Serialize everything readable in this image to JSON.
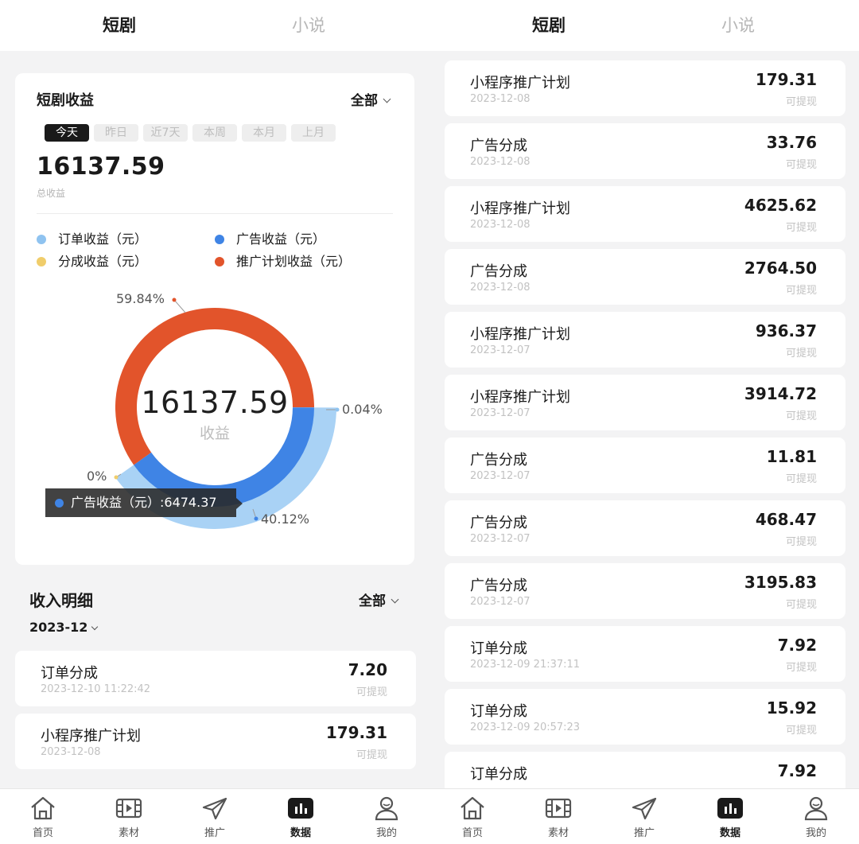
{
  "left": {
    "tabs": [
      {
        "label": "短剧",
        "active": true
      },
      {
        "label": "小说",
        "active": false
      }
    ],
    "earnings": {
      "title": "短剧收益",
      "filter_label": "全部",
      "ranges": [
        {
          "label": "今天",
          "active": true
        },
        {
          "label": "昨日",
          "active": false
        },
        {
          "label": "近7天",
          "active": false
        },
        {
          "label": "本周",
          "active": false
        },
        {
          "label": "本月",
          "active": false
        },
        {
          "label": "上月",
          "active": false
        }
      ],
      "total": "16137.59",
      "total_label": "总收益",
      "legend": [
        {
          "label": "订单收益（元）",
          "color": "#8fc3f0"
        },
        {
          "label": "广告收益（元）",
          "color": "#3f84e5"
        },
        {
          "label": "分成收益（元）",
          "color": "#f0cd6b"
        },
        {
          "label": "推广计划收益（元）",
          "color": "#e2542b"
        }
      ],
      "donut": {
        "center_value": "16137.59",
        "center_label": "收益",
        "slices": [
          {
            "name": "推广计划收益（元）",
            "percent": 59.84,
            "label": "59.84%",
            "color": "#e2542b"
          },
          {
            "name": "订单收益（元）",
            "percent": 0.04,
            "label": "0.04%",
            "color": "#8fc3f0"
          },
          {
            "name": "广告收益（元）",
            "percent": 40.12,
            "label": "40.12%",
            "color": "#3f84e5"
          },
          {
            "name": "分成收益（元）",
            "percent": 0,
            "label": "0%",
            "color": "#f0cd6b"
          }
        ],
        "highlight_color": "#a9d2f5",
        "tooltip": "广告收益（元）:6474.37"
      }
    },
    "detail": {
      "title": "收入明细",
      "filter_label": "全部",
      "month": "2023-12",
      "items": [
        {
          "name": "订单分成",
          "date": "2023-12-10 11:22:42",
          "amount": "7.20",
          "status": "可提现"
        },
        {
          "name": "小程序推广计划",
          "date": "2023-12-08",
          "amount": "179.31",
          "status": "可提现"
        }
      ]
    },
    "nav": [
      {
        "label": "首页",
        "icon": "home-icon",
        "active": false
      },
      {
        "label": "素材",
        "icon": "film-icon",
        "active": false
      },
      {
        "label": "推广",
        "icon": "paper-plane-icon",
        "active": false
      },
      {
        "label": "数据",
        "icon": "bar-chart-icon",
        "active": true
      },
      {
        "label": "我的",
        "icon": "user-icon",
        "active": false
      }
    ]
  },
  "right": {
    "tabs": [
      {
        "label": "短剧",
        "active": true
      },
      {
        "label": "小说",
        "active": false
      }
    ],
    "items": [
      {
        "name": "小程序推广计划",
        "date": "2023-12-08",
        "amount": "179.31",
        "status": "可提现"
      },
      {
        "name": "广告分成",
        "date": "2023-12-08",
        "amount": "33.76",
        "status": "可提现"
      },
      {
        "name": "小程序推广计划",
        "date": "2023-12-08",
        "amount": "4625.62",
        "status": "可提现"
      },
      {
        "name": "广告分成",
        "date": "2023-12-08",
        "amount": "2764.50",
        "status": "可提现"
      },
      {
        "name": "小程序推广计划",
        "date": "2023-12-07",
        "amount": "936.37",
        "status": "可提现"
      },
      {
        "name": "小程序推广计划",
        "date": "2023-12-07",
        "amount": "3914.72",
        "status": "可提现"
      },
      {
        "name": "广告分成",
        "date": "2023-12-07",
        "amount": "11.81",
        "status": "可提现"
      },
      {
        "name": "广告分成",
        "date": "2023-12-07",
        "amount": "468.47",
        "status": "可提现"
      },
      {
        "name": "广告分成",
        "date": "2023-12-07",
        "amount": "3195.83",
        "status": "可提现"
      },
      {
        "name": "订单分成",
        "date": "2023-12-09 21:37:11",
        "amount": "7.92",
        "status": "可提现"
      },
      {
        "name": "订单分成",
        "date": "2023-12-09 20:57:23",
        "amount": "15.92",
        "status": "可提现"
      },
      {
        "name": "订单分成",
        "date": "",
        "amount": "7.92",
        "status": ""
      }
    ],
    "nav": [
      {
        "label": "首页",
        "icon": "home-icon",
        "active": false
      },
      {
        "label": "素材",
        "icon": "film-icon",
        "active": false
      },
      {
        "label": "推广",
        "icon": "paper-plane-icon",
        "active": false
      },
      {
        "label": "数据",
        "icon": "bar-chart-icon",
        "active": true
      },
      {
        "label": "我的",
        "icon": "user-icon",
        "active": false
      }
    ]
  }
}
